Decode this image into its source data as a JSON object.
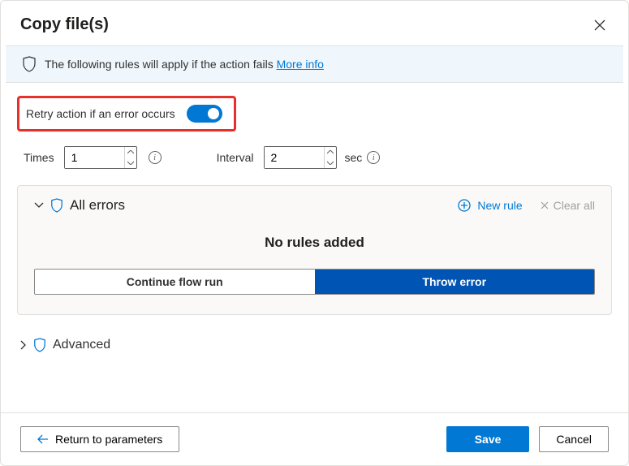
{
  "dialog": {
    "title": "Copy file(s)"
  },
  "banner": {
    "text": "The following rules will apply if the action fails ",
    "link": "More info"
  },
  "retry": {
    "label": "Retry action if an error occurs",
    "enabled": true
  },
  "params": {
    "times_label": "Times",
    "times_value": "1",
    "interval_label": "Interval",
    "interval_value": "2",
    "unit": "sec"
  },
  "rules": {
    "section_title": "All errors",
    "new_rule_label": "New rule",
    "clear_all_label": "Clear all",
    "empty_text": "No rules added",
    "option_continue": "Continue flow run",
    "option_throw": "Throw error"
  },
  "advanced": {
    "label": "Advanced"
  },
  "footer": {
    "return_label": "Return to parameters",
    "save_label": "Save",
    "cancel_label": "Cancel"
  },
  "colors": {
    "primary": "#0078d4",
    "highlight_border": "#e8302b"
  }
}
